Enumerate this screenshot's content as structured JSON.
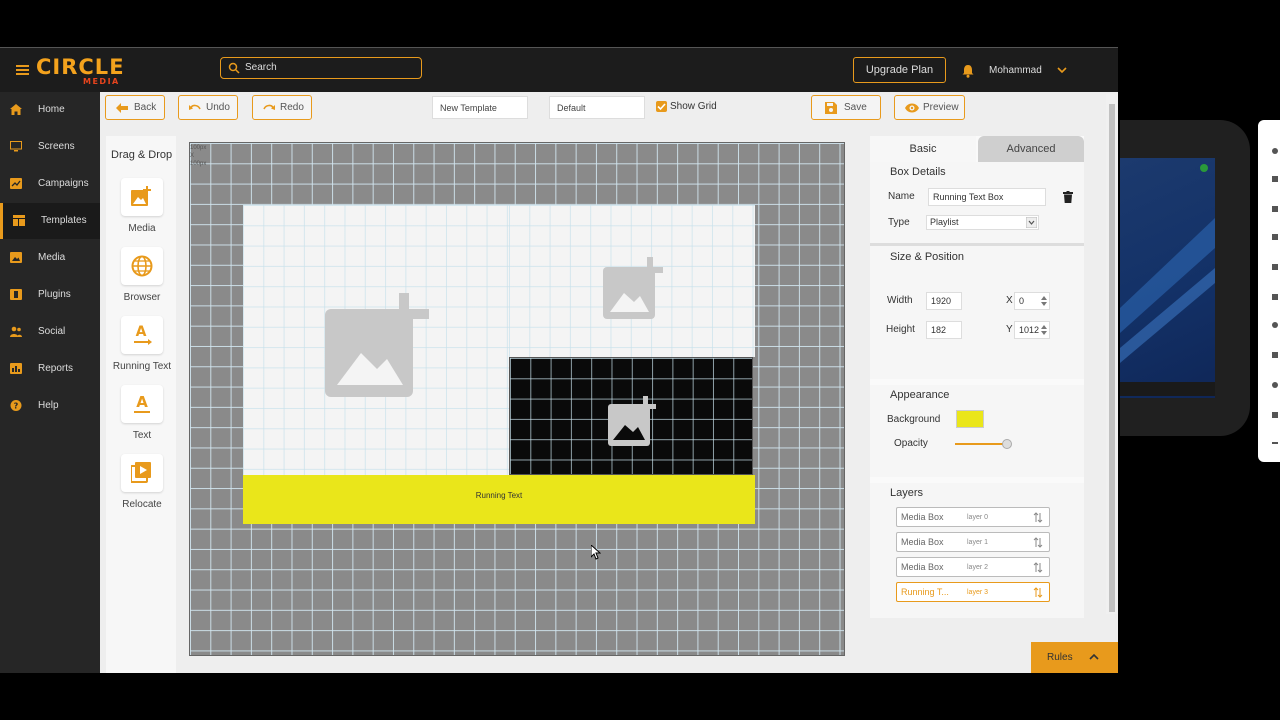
{
  "app": {
    "logo_main": "CIRCLE",
    "logo_sub": "MEDIA",
    "search_placeholder": "Search",
    "upgrade_label": "Upgrade Plan",
    "username": "Mohammad",
    "accent_color": "#e89a1c"
  },
  "sidebar": {
    "items": [
      {
        "label": "Home",
        "icon": "home-icon"
      },
      {
        "label": "Screens",
        "icon": "monitor-icon"
      },
      {
        "label": "Campaigns",
        "icon": "campaign-icon"
      },
      {
        "label": "Templates",
        "icon": "template-icon",
        "active": true
      },
      {
        "label": "Media",
        "icon": "image-icon"
      },
      {
        "label": "Plugins",
        "icon": "plugin-icon"
      },
      {
        "label": "Social",
        "icon": "users-icon"
      },
      {
        "label": "Reports",
        "icon": "report-icon"
      },
      {
        "label": "Help",
        "icon": "help-icon"
      }
    ]
  },
  "toolbar": {
    "back_label": "Back",
    "undo_label": "Undo",
    "redo_label": "Redo",
    "template_name": "New Template",
    "preset": "Default",
    "show_grid_label": "Show Grid",
    "show_grid_checked": true,
    "save_label": "Save",
    "preview_label": "Preview"
  },
  "dragdrop": {
    "title": "Drag & Drop",
    "items": [
      {
        "label": "Media",
        "icon": "add-image-icon"
      },
      {
        "label": "Browser",
        "icon": "globe-icon"
      },
      {
        "label": "Running Text",
        "icon": "running-text-icon"
      },
      {
        "label": "Text",
        "icon": "text-icon"
      },
      {
        "label": "Relocate",
        "icon": "relocate-icon"
      }
    ]
  },
  "canvas": {
    "ruler_label_1": "100px",
    "ruler_label_2": "X",
    "ruler_label_3": "100px",
    "running_text": "Running Text",
    "running_bg": "#eae61a"
  },
  "panel": {
    "tab_basic": "Basic",
    "tab_advanced": "Advanced",
    "box_details_title": "Box Details",
    "name_label": "Name",
    "name_value": "Running Text Box",
    "type_label": "Type",
    "type_value": "Playlist",
    "size_title": "Size & Position",
    "width_label": "Width",
    "width_value": "1920",
    "height_label": "Height",
    "height_value": "182",
    "x_label": "X",
    "x_value": "0",
    "y_label": "Y",
    "y_value": "1012",
    "appearance_title": "Appearance",
    "background_label": "Background",
    "background_color": "#eae61a",
    "opacity_label": "Opacity",
    "opacity_value": 1.0,
    "layers_title": "Layers",
    "layers": [
      {
        "name": "Media Box",
        "z": "layer 0"
      },
      {
        "name": "Media Box",
        "z": "layer 1"
      },
      {
        "name": "Media Box",
        "z": "layer 2"
      },
      {
        "name": "Running T...",
        "z": "layer 3",
        "selected": true
      }
    ]
  },
  "rules_label": "Rules"
}
